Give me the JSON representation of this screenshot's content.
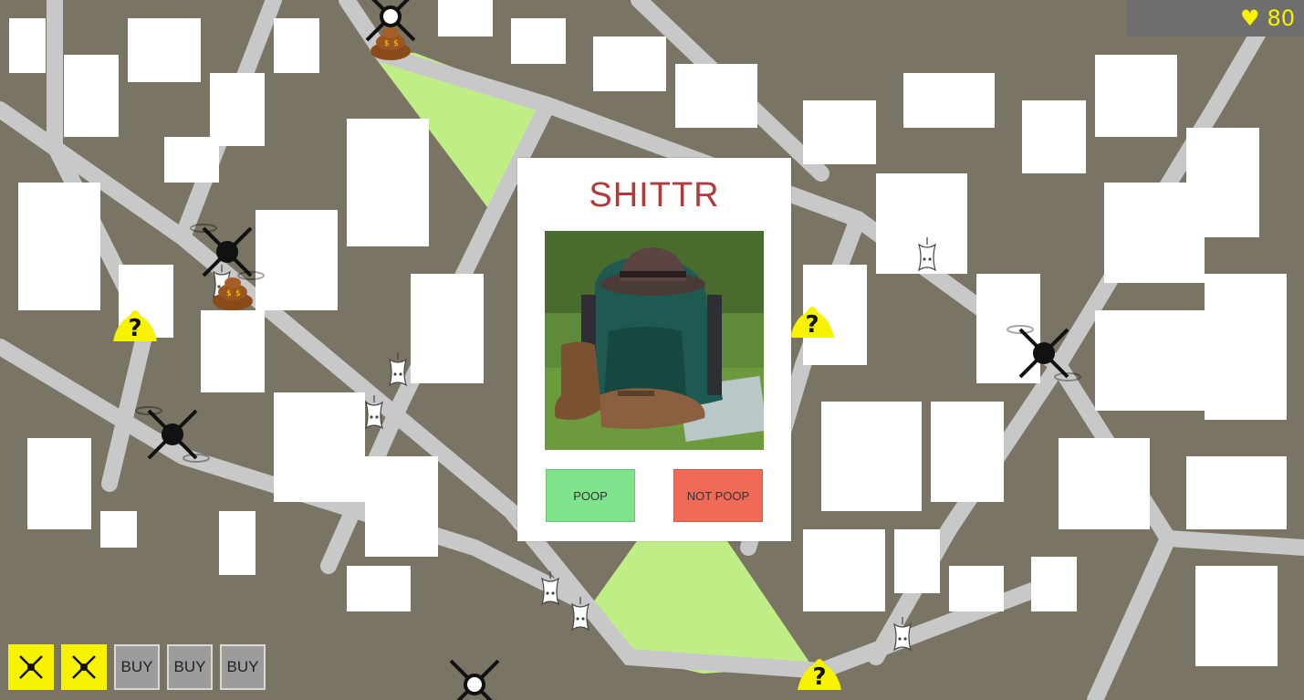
{
  "hud": {
    "health_icon": "heart-icon",
    "health_value": "80",
    "color": "#f6f200"
  },
  "modal": {
    "title": "SHITTR",
    "photo_subject": "backpack-hat-boots-photo",
    "poop_label": "POOP",
    "not_poop_label": "NOT POOP",
    "title_color": "#b23a3a"
  },
  "toolbar": {
    "drone_slots": [
      "drone-icon",
      "drone-icon"
    ],
    "buy_buttons": [
      "BUY",
      "BUY",
      "BUY"
    ]
  },
  "map": {
    "background_color": "#7a7464",
    "building_color": "#ffffff",
    "road_color": "#c8c8c8",
    "park_color": "#c0ee86",
    "marker_color": "#f6f200"
  }
}
